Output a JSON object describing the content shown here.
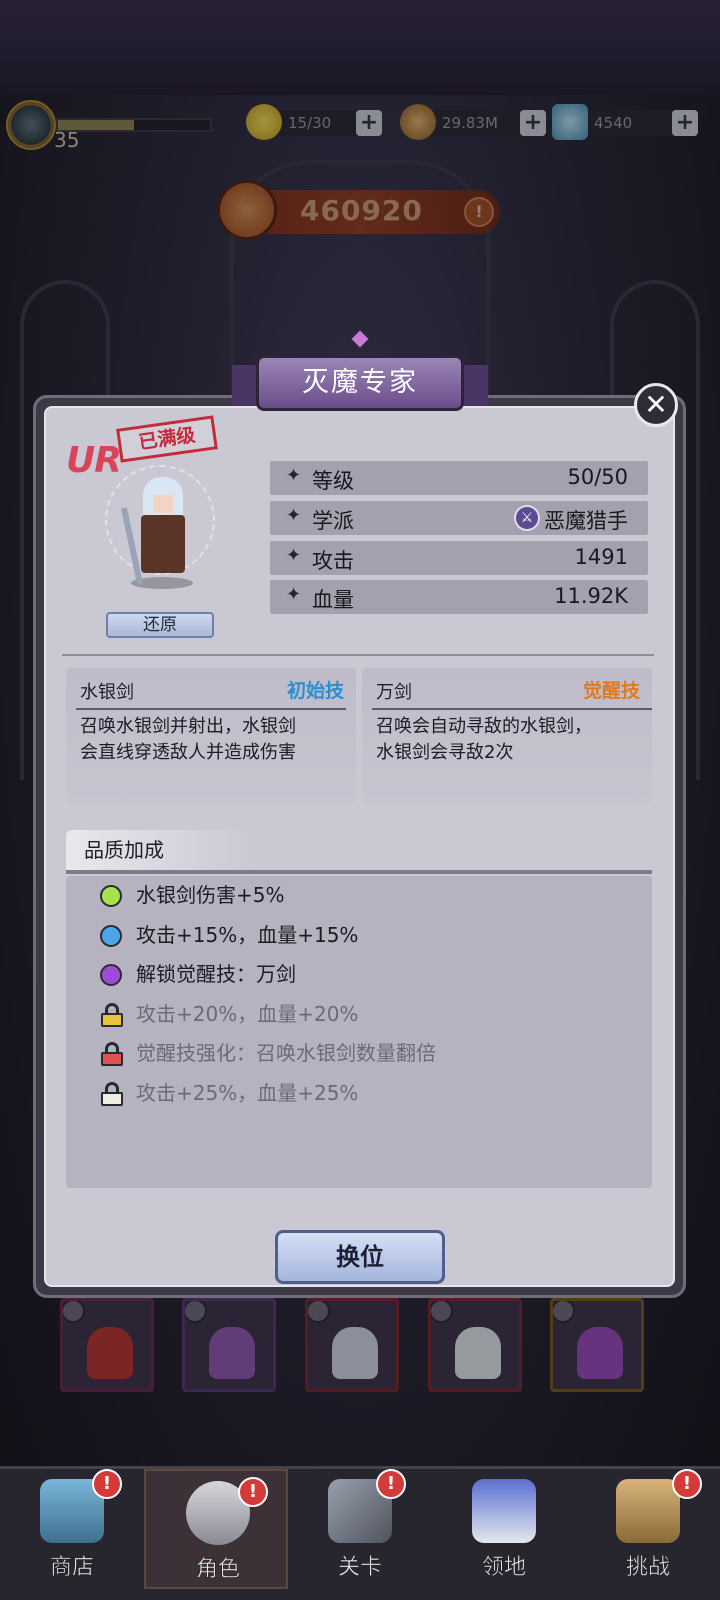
{
  "topbar": {
    "level": "35",
    "exp_fraction": 0.5,
    "stamina": "15/30",
    "coins": "29.83M",
    "gems": "4540",
    "plus": "+"
  },
  "power": {
    "value": "460920",
    "warn": "!"
  },
  "dialog": {
    "title": "灭魔专家",
    "close": "✕",
    "rarity": "UR",
    "max_stamp": "已满级",
    "restore_label": "还原",
    "stats": [
      {
        "label": "等级",
        "value": "50/50"
      },
      {
        "label": "学派",
        "value": "恶魔猎手"
      },
      {
        "label": "攻击",
        "value": "1491"
      },
      {
        "label": "血量",
        "value": "11.92K"
      }
    ],
    "skills": [
      {
        "name": "水银剑",
        "tag": "初始技",
        "tag_color": "#2a8fd0",
        "desc_1": "召唤水银剑并射出，水银剑",
        "desc_2": "会直线穿透敌人并造成伤害"
      },
      {
        "name": "万剑",
        "tag": "觉醒技",
        "tag_color": "#e07a1c",
        "desc_1": "召唤会自动寻敌的水银剑，",
        "desc_2": "水银剑会寻敌2次"
      }
    ],
    "quality_title": "品质加成",
    "quality": [
      {
        "text": "水银剑伤害+5%",
        "icon": "green-dot",
        "color": "#a6e34a",
        "locked": false
      },
      {
        "text": "攻击+15%，血量+15%",
        "icon": "blue-dot",
        "color": "#4aa6e8",
        "locked": false
      },
      {
        "text": "解锁觉醒技：万剑",
        "icon": "purple-dot",
        "color": "#a04ad8",
        "locked": false
      },
      {
        "text": "攻击+20%，血量+20%",
        "icon": "lock-icon",
        "color": "#e8c43a",
        "locked": true
      },
      {
        "text": "觉醒技强化：召唤水银剑数量翻倍",
        "icon": "lock-icon",
        "color": "#e0524e",
        "locked": true
      },
      {
        "text": "攻击+25%，血量+25%",
        "icon": "lock-icon",
        "color": "#f2ede2",
        "locked": true
      }
    ],
    "swap_label": "换位"
  },
  "nav": [
    {
      "label": "商店",
      "badge": "!"
    },
    {
      "label": "角色",
      "badge": "!"
    },
    {
      "label": "关卡",
      "badge": "!"
    },
    {
      "label": "领地",
      "badge": ""
    },
    {
      "label": "挑战",
      "badge": "!"
    }
  ],
  "colors": {
    "accent": "#6a4d8a",
    "locked_text": "#6b6a75",
    "unlocked_text": "#1c1c24"
  }
}
